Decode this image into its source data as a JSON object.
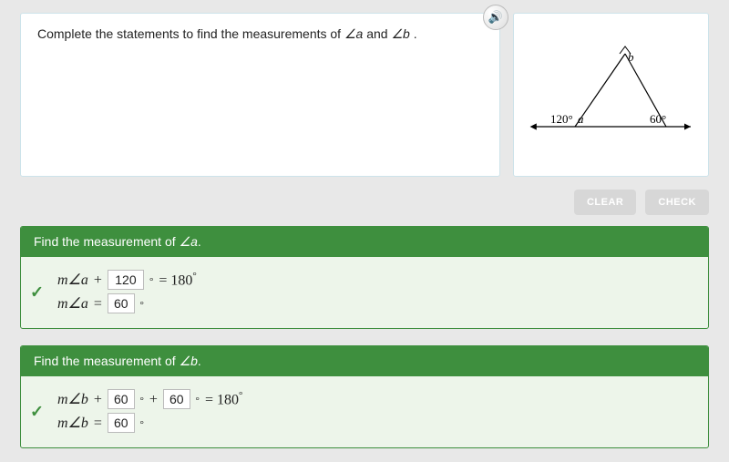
{
  "prompt": {
    "prefix": "Complete the statements to find the measurements of ",
    "angle1": "a",
    "conj": " and ",
    "angle2": "b",
    "suffix": " ."
  },
  "diagram": {
    "left_angle_label": "120°",
    "right_angle_label": "60°",
    "vertex_a": "a",
    "vertex_b": "b"
  },
  "buttons": {
    "clear": "CLEAR",
    "check": "CHECK"
  },
  "section_a": {
    "header_prefix": "Find the measurement of ",
    "header_angle": "a",
    "header_suffix": ".",
    "line1": {
      "lhs": "m∠a",
      "op": "+",
      "input": "120",
      "eq": "= 180"
    },
    "line2": {
      "lhs": "m∠a",
      "op": "=",
      "input": "60"
    }
  },
  "section_b": {
    "header_prefix": "Find the measurement of ",
    "header_angle": "b",
    "header_suffix": ".",
    "line1": {
      "lhs": "m∠b",
      "op": "+",
      "input1": "60",
      "op2": "+",
      "input2": "60",
      "eq": "= 180"
    },
    "line2": {
      "lhs": "m∠b",
      "op": "=",
      "input": "60"
    }
  },
  "icons": {
    "audio": "🔊"
  }
}
